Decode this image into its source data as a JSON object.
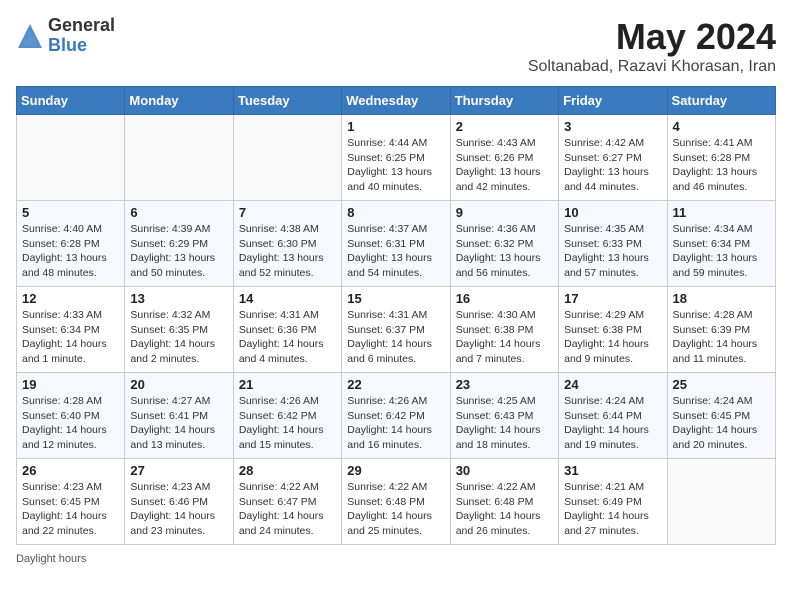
{
  "header": {
    "logo_general": "General",
    "logo_blue": "Blue",
    "month_title": "May 2024",
    "location": "Soltanabad, Razavi Khorasan, Iran"
  },
  "days_of_week": [
    "Sunday",
    "Monday",
    "Tuesday",
    "Wednesday",
    "Thursday",
    "Friday",
    "Saturday"
  ],
  "weeks": [
    [
      {
        "day": "",
        "info": ""
      },
      {
        "day": "",
        "info": ""
      },
      {
        "day": "",
        "info": ""
      },
      {
        "day": "1",
        "info": "Sunrise: 4:44 AM\nSunset: 6:25 PM\nDaylight: 13 hours\nand 40 minutes."
      },
      {
        "day": "2",
        "info": "Sunrise: 4:43 AM\nSunset: 6:26 PM\nDaylight: 13 hours\nand 42 minutes."
      },
      {
        "day": "3",
        "info": "Sunrise: 4:42 AM\nSunset: 6:27 PM\nDaylight: 13 hours\nand 44 minutes."
      },
      {
        "day": "4",
        "info": "Sunrise: 4:41 AM\nSunset: 6:28 PM\nDaylight: 13 hours\nand 46 minutes."
      }
    ],
    [
      {
        "day": "5",
        "info": "Sunrise: 4:40 AM\nSunset: 6:28 PM\nDaylight: 13 hours\nand 48 minutes."
      },
      {
        "day": "6",
        "info": "Sunrise: 4:39 AM\nSunset: 6:29 PM\nDaylight: 13 hours\nand 50 minutes."
      },
      {
        "day": "7",
        "info": "Sunrise: 4:38 AM\nSunset: 6:30 PM\nDaylight: 13 hours\nand 52 minutes."
      },
      {
        "day": "8",
        "info": "Sunrise: 4:37 AM\nSunset: 6:31 PM\nDaylight: 13 hours\nand 54 minutes."
      },
      {
        "day": "9",
        "info": "Sunrise: 4:36 AM\nSunset: 6:32 PM\nDaylight: 13 hours\nand 56 minutes."
      },
      {
        "day": "10",
        "info": "Sunrise: 4:35 AM\nSunset: 6:33 PM\nDaylight: 13 hours\nand 57 minutes."
      },
      {
        "day": "11",
        "info": "Sunrise: 4:34 AM\nSunset: 6:34 PM\nDaylight: 13 hours\nand 59 minutes."
      }
    ],
    [
      {
        "day": "12",
        "info": "Sunrise: 4:33 AM\nSunset: 6:34 PM\nDaylight: 14 hours\nand 1 minute."
      },
      {
        "day": "13",
        "info": "Sunrise: 4:32 AM\nSunset: 6:35 PM\nDaylight: 14 hours\nand 2 minutes."
      },
      {
        "day": "14",
        "info": "Sunrise: 4:31 AM\nSunset: 6:36 PM\nDaylight: 14 hours\nand 4 minutes."
      },
      {
        "day": "15",
        "info": "Sunrise: 4:31 AM\nSunset: 6:37 PM\nDaylight: 14 hours\nand 6 minutes."
      },
      {
        "day": "16",
        "info": "Sunrise: 4:30 AM\nSunset: 6:38 PM\nDaylight: 14 hours\nand 7 minutes."
      },
      {
        "day": "17",
        "info": "Sunrise: 4:29 AM\nSunset: 6:38 PM\nDaylight: 14 hours\nand 9 minutes."
      },
      {
        "day": "18",
        "info": "Sunrise: 4:28 AM\nSunset: 6:39 PM\nDaylight: 14 hours\nand 11 minutes."
      }
    ],
    [
      {
        "day": "19",
        "info": "Sunrise: 4:28 AM\nSunset: 6:40 PM\nDaylight: 14 hours\nand 12 minutes."
      },
      {
        "day": "20",
        "info": "Sunrise: 4:27 AM\nSunset: 6:41 PM\nDaylight: 14 hours\nand 13 minutes."
      },
      {
        "day": "21",
        "info": "Sunrise: 4:26 AM\nSunset: 6:42 PM\nDaylight: 14 hours\nand 15 minutes."
      },
      {
        "day": "22",
        "info": "Sunrise: 4:26 AM\nSunset: 6:42 PM\nDaylight: 14 hours\nand 16 minutes."
      },
      {
        "day": "23",
        "info": "Sunrise: 4:25 AM\nSunset: 6:43 PM\nDaylight: 14 hours\nand 18 minutes."
      },
      {
        "day": "24",
        "info": "Sunrise: 4:24 AM\nSunset: 6:44 PM\nDaylight: 14 hours\nand 19 minutes."
      },
      {
        "day": "25",
        "info": "Sunrise: 4:24 AM\nSunset: 6:45 PM\nDaylight: 14 hours\nand 20 minutes."
      }
    ],
    [
      {
        "day": "26",
        "info": "Sunrise: 4:23 AM\nSunset: 6:45 PM\nDaylight: 14 hours\nand 22 minutes."
      },
      {
        "day": "27",
        "info": "Sunrise: 4:23 AM\nSunset: 6:46 PM\nDaylight: 14 hours\nand 23 minutes."
      },
      {
        "day": "28",
        "info": "Sunrise: 4:22 AM\nSunset: 6:47 PM\nDaylight: 14 hours\nand 24 minutes."
      },
      {
        "day": "29",
        "info": "Sunrise: 4:22 AM\nSunset: 6:48 PM\nDaylight: 14 hours\nand 25 minutes."
      },
      {
        "day": "30",
        "info": "Sunrise: 4:22 AM\nSunset: 6:48 PM\nDaylight: 14 hours\nand 26 minutes."
      },
      {
        "day": "31",
        "info": "Sunrise: 4:21 AM\nSunset: 6:49 PM\nDaylight: 14 hours\nand 27 minutes."
      },
      {
        "day": "",
        "info": ""
      }
    ]
  ],
  "footer": {
    "daylight_label": "Daylight hours"
  }
}
